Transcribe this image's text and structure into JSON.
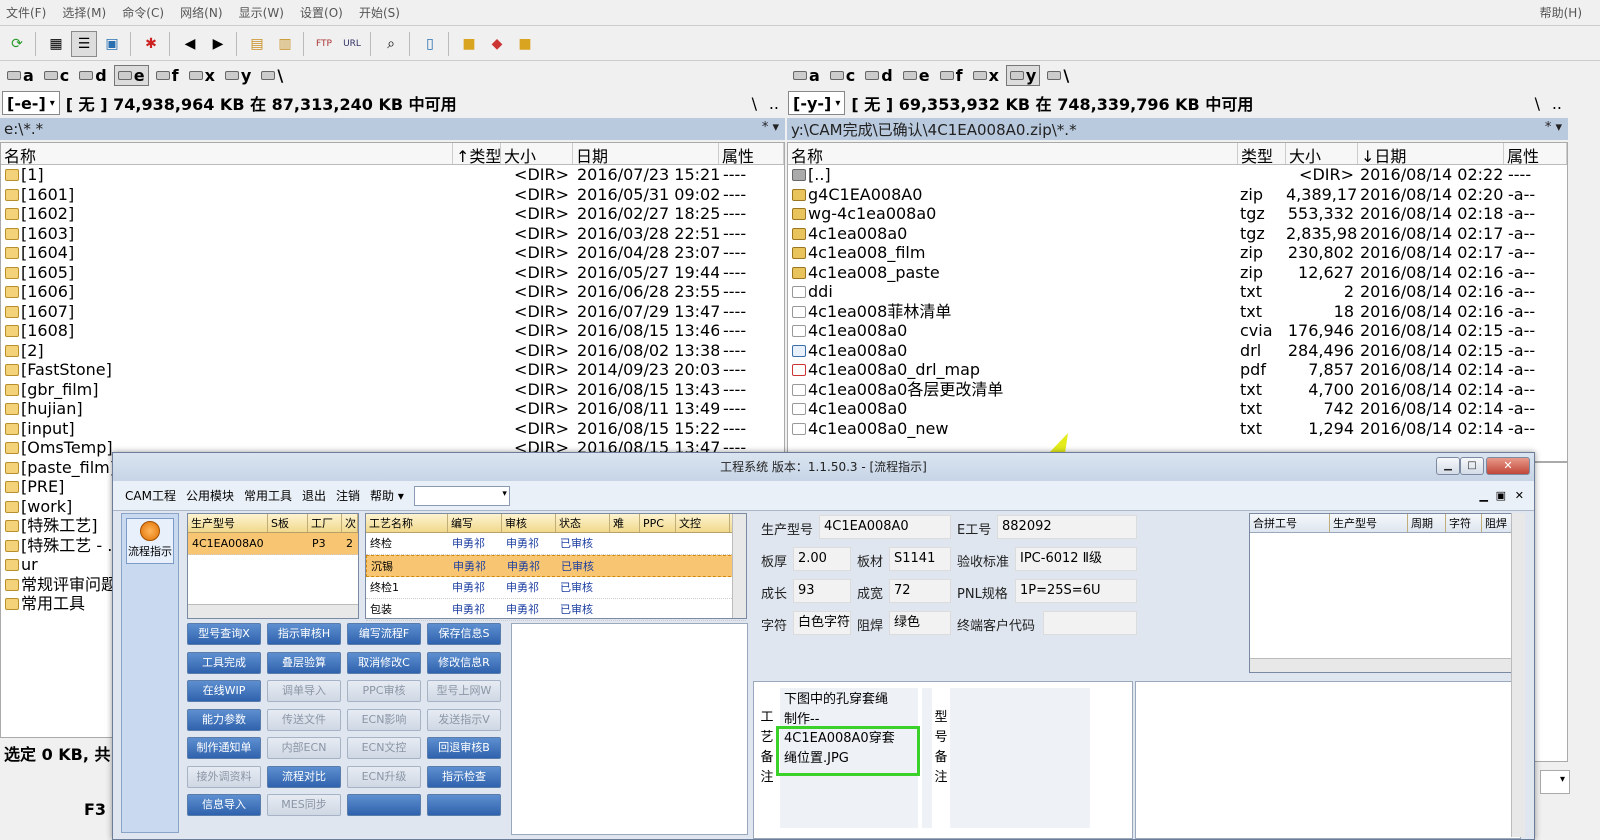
{
  "menu": {
    "items": [
      "文件(F)",
      "选择(M)",
      "命令(C)",
      "网络(N)",
      "显示(W)",
      "设置(O)",
      "开始(S)"
    ],
    "help": "帮助(H)"
  },
  "drives": {
    "left": [
      "a",
      "c",
      "d",
      "e",
      "f",
      "x",
      "y",
      "\\"
    ],
    "right": [
      "a",
      "c",
      "d",
      "e",
      "f",
      "x",
      "y",
      "\\"
    ]
  },
  "left": {
    "drive_select": "[-e-]",
    "space": "[ 无 ]  74,938,964 KB 在 87,313,240 KB 中可用",
    "root_btn": "\\",
    "up_btn": "..",
    "path": "e:\\*.*",
    "path_star": "*  ▾",
    "cols": [
      "名称",
      "↑类型",
      "大小",
      "日期",
      "属性"
    ],
    "files": [
      {
        "name": "[1]",
        "size": "<DIR>",
        "date": "2016/07/23 15:21",
        "attr": "----"
      },
      {
        "name": "[1601]",
        "size": "<DIR>",
        "date": "2016/05/31 09:02",
        "attr": "----"
      },
      {
        "name": "[1602]",
        "size": "<DIR>",
        "date": "2016/02/27 18:25",
        "attr": "----"
      },
      {
        "name": "[1603]",
        "size": "<DIR>",
        "date": "2016/03/28 22:51",
        "attr": "----"
      },
      {
        "name": "[1604]",
        "size": "<DIR>",
        "date": "2016/04/28 23:07",
        "attr": "----"
      },
      {
        "name": "[1605]",
        "size": "<DIR>",
        "date": "2016/05/27 19:44",
        "attr": "----"
      },
      {
        "name": "[1606]",
        "size": "<DIR>",
        "date": "2016/06/28 23:55",
        "attr": "----"
      },
      {
        "name": "[1607]",
        "size": "<DIR>",
        "date": "2016/07/29 13:47",
        "attr": "----"
      },
      {
        "name": "[1608]",
        "size": "<DIR>",
        "date": "2016/08/15 13:46",
        "attr": "----"
      },
      {
        "name": "[2]",
        "size": "<DIR>",
        "date": "2016/08/02 13:38",
        "attr": "----"
      },
      {
        "name": "[FastStone]",
        "size": "<DIR>",
        "date": "2014/09/23 20:03",
        "attr": "----"
      },
      {
        "name": "[gbr_film]",
        "size": "<DIR>",
        "date": "2016/08/15 13:43",
        "attr": "----"
      },
      {
        "name": "[hujian]",
        "size": "<DIR>",
        "date": "2016/08/11 13:49",
        "attr": "----"
      },
      {
        "name": "[input]",
        "size": "<DIR>",
        "date": "2016/08/15 15:22",
        "attr": "----"
      },
      {
        "name": "[OmsTemp]",
        "size": "<DIR>",
        "date": "2016/08/15 13:47",
        "attr": "----"
      },
      {
        "name": "[paste_film]",
        "size": "",
        "date": "",
        "attr": ""
      },
      {
        "name": "[PRE]",
        "size": "",
        "date": "",
        "attr": ""
      },
      {
        "name": "[work]",
        "size": "",
        "date": "",
        "attr": ""
      },
      {
        "name": "[特殊工艺]",
        "size": "",
        "date": "",
        "attr": ""
      },
      {
        "name": "[特殊工艺 - ...",
        "size": "",
        "date": "",
        "attr": ""
      },
      {
        "name": "ur",
        "size": "",
        "date": "",
        "attr": ""
      },
      {
        "name": "常规评审问题",
        "size": "",
        "date": "",
        "attr": ""
      },
      {
        "name": "常用工具",
        "size": "",
        "date": "",
        "attr": ""
      }
    ],
    "status": "选定 0 KB, 共 ...",
    "fkey": "F3"
  },
  "right": {
    "drive_select": "[-y-]",
    "space": "[ 无 ]  69,353,932 KB 在 748,339,796 KB 中可用",
    "root_btn": "\\",
    "up_btn": "..",
    "path": "y:\\CAM完成\\已确认\\4C1EA008A0.zip\\*.*",
    "path_star": "*  ▾",
    "cols": [
      "名称",
      "类型",
      "大小",
      "↓日期",
      "属性"
    ],
    "files": [
      {
        "icon": "updir",
        "name": "[..]",
        "type": "",
        "size": "<DIR>",
        "date": "2016/08/14 02:22",
        "attr": "----"
      },
      {
        "icon": "zip",
        "name": "g4C1EA008A0",
        "type": "zip",
        "size": "4,389,179",
        "date": "2016/08/14 02:20",
        "attr": "-a--"
      },
      {
        "icon": "zip",
        "name": "wg-4c1ea008a0",
        "type": "tgz",
        "size": "553,332",
        "date": "2016/08/14 02:18",
        "attr": "-a--"
      },
      {
        "icon": "zip",
        "name": "4c1ea008a0",
        "type": "tgz",
        "size": "2,835,984",
        "date": "2016/08/14 02:17",
        "attr": "-a--"
      },
      {
        "icon": "zip",
        "name": "4c1ea008_film",
        "type": "zip",
        "size": "230,802",
        "date": "2016/08/14 02:17",
        "attr": "-a--"
      },
      {
        "icon": "zip",
        "name": "4c1ea008_paste",
        "type": "zip",
        "size": "12,627",
        "date": "2016/08/14 02:16",
        "attr": "-a--"
      },
      {
        "icon": "txt",
        "name": "ddi",
        "type": "txt",
        "size": "2",
        "date": "2016/08/14 02:16",
        "attr": "-a--"
      },
      {
        "icon": "txt",
        "name": "4c1ea008菲林清单",
        "type": "txt",
        "size": "18",
        "date": "2016/08/14 02:16",
        "attr": "-a--"
      },
      {
        "icon": "txt",
        "name": "4c1ea008a0",
        "type": "cvia",
        "size": "176,946",
        "date": "2016/08/14 02:15",
        "attr": "-a--"
      },
      {
        "icon": "drl",
        "name": "4c1ea008a0",
        "type": "drl",
        "size": "284,496",
        "date": "2016/08/14 02:15",
        "attr": "-a--"
      },
      {
        "icon": "pdf",
        "name": "4c1ea008a0_drl_map",
        "type": "pdf",
        "size": "7,857",
        "date": "2016/08/14 02:14",
        "attr": "-a--"
      },
      {
        "icon": "txt",
        "name": "4c1ea008a0各层更改清单",
        "type": "txt",
        "size": "4,700",
        "date": "2016/08/14 02:14",
        "attr": "-a--"
      },
      {
        "icon": "txt",
        "name": "4c1ea008a0",
        "type": "txt",
        "size": "742",
        "date": "2016/08/14 02:14",
        "attr": "-a--"
      },
      {
        "icon": "txt",
        "name": "4c1ea008a0_new",
        "type": "txt",
        "size": "1,294",
        "date": "2016/08/14 02:14",
        "attr": "-a--"
      }
    ]
  },
  "dialog": {
    "title": "工程系统   版本：1.1.50.3 - [流程指示]",
    "menu": [
      "CAM工程",
      "公用模块",
      "常用工具",
      "退出",
      "注销",
      "帮助 ▾"
    ],
    "flow_btn": "流程指示",
    "model_grid": {
      "cols": [
        "生产型号",
        "S板",
        "工厂",
        "次"
      ],
      "rows": [
        [
          "4C1EA008A0",
          "",
          "P3",
          "2"
        ]
      ]
    },
    "process_grid": {
      "cols": [
        "工艺名称",
        "编写",
        "审核",
        "状态",
        "难",
        "PPC",
        "文控"
      ],
      "rows": [
        [
          "终检",
          "申勇祁",
          "申勇祁",
          "已审核",
          "",
          "",
          ""
        ],
        [
          "沉锡",
          "申勇祁",
          "申勇祁",
          "已审核",
          "",
          "",
          ""
        ],
        [
          "终检1",
          "申勇祁",
          "申勇祁",
          "已审核",
          "",
          "",
          ""
        ],
        [
          "包装",
          "申勇祁",
          "申勇祁",
          "已审核",
          "",
          "",
          ""
        ]
      ]
    },
    "buttons": [
      {
        "label": "型号查询X",
        "enabled": true
      },
      {
        "label": "指示审核H",
        "enabled": true
      },
      {
        "label": "编写流程F",
        "enabled": true
      },
      {
        "label": "保存信息S",
        "enabled": true
      },
      {
        "label": "工具完成",
        "enabled": true
      },
      {
        "label": "叠层验算",
        "enabled": true
      },
      {
        "label": "取消修改C",
        "enabled": true
      },
      {
        "label": "修改信息R",
        "enabled": true
      },
      {
        "label": "在线WIP",
        "enabled": true
      },
      {
        "label": "调单导入",
        "enabled": false
      },
      {
        "label": "PPC审核",
        "enabled": false
      },
      {
        "label": "型号上网W",
        "enabled": false
      },
      {
        "label": "能力参数",
        "enabled": true
      },
      {
        "label": "传送文件",
        "enabled": false
      },
      {
        "label": "ECN影响",
        "enabled": false
      },
      {
        "label": "发送指示V",
        "enabled": false
      },
      {
        "label": "制作通知单",
        "enabled": true
      },
      {
        "label": "内部ECN",
        "enabled": false
      },
      {
        "label": "ECN文控",
        "enabled": false
      },
      {
        "label": "回退审核B",
        "enabled": true
      },
      {
        "label": "接外调资料",
        "enabled": false
      },
      {
        "label": "流程对比",
        "enabled": true
      },
      {
        "label": "ECN升级",
        "enabled": false
      },
      {
        "label": "指示检查",
        "enabled": true
      },
      {
        "label": "信息导入",
        "enabled": true
      },
      {
        "label": "MES同步",
        "enabled": false
      },
      {
        "label": "",
        "enabled": true
      },
      {
        "label": "",
        "enabled": true
      }
    ],
    "info": {
      "prod_model_label": "生产型号",
      "prod_model": "4C1EA008A0",
      "eno_label": "E工号",
      "eno": "882092",
      "thickness_label": "板厚",
      "thickness": "2.00",
      "material_label": "板材",
      "material": "S1141",
      "accept_label": "验收标准",
      "accept": "IPC-6012 Ⅱ级",
      "length_label": "成长",
      "length": "93",
      "width_label": "成宽",
      "width": "72",
      "pnl_label": "PNL规格",
      "pnl": "1P=25S=6U",
      "char_label": "字符",
      "char": "白色字符",
      "solder_label": "阻焊",
      "solder": "绿色",
      "endcust_label": "终端客户代码",
      "endcust": ""
    },
    "right_grid_cols": [
      "合拼工号",
      "生产型号",
      "周期",
      "字符",
      "阻焊"
    ],
    "notes_label": [
      "工",
      "艺",
      "备",
      "注"
    ],
    "model_notes_label": [
      "型",
      "号",
      "备",
      "注"
    ],
    "memo": [
      "下图中的孔穿套绳",
      "制作--",
      "4C1EA008A0穿套",
      "绳位置.JPG"
    ]
  }
}
